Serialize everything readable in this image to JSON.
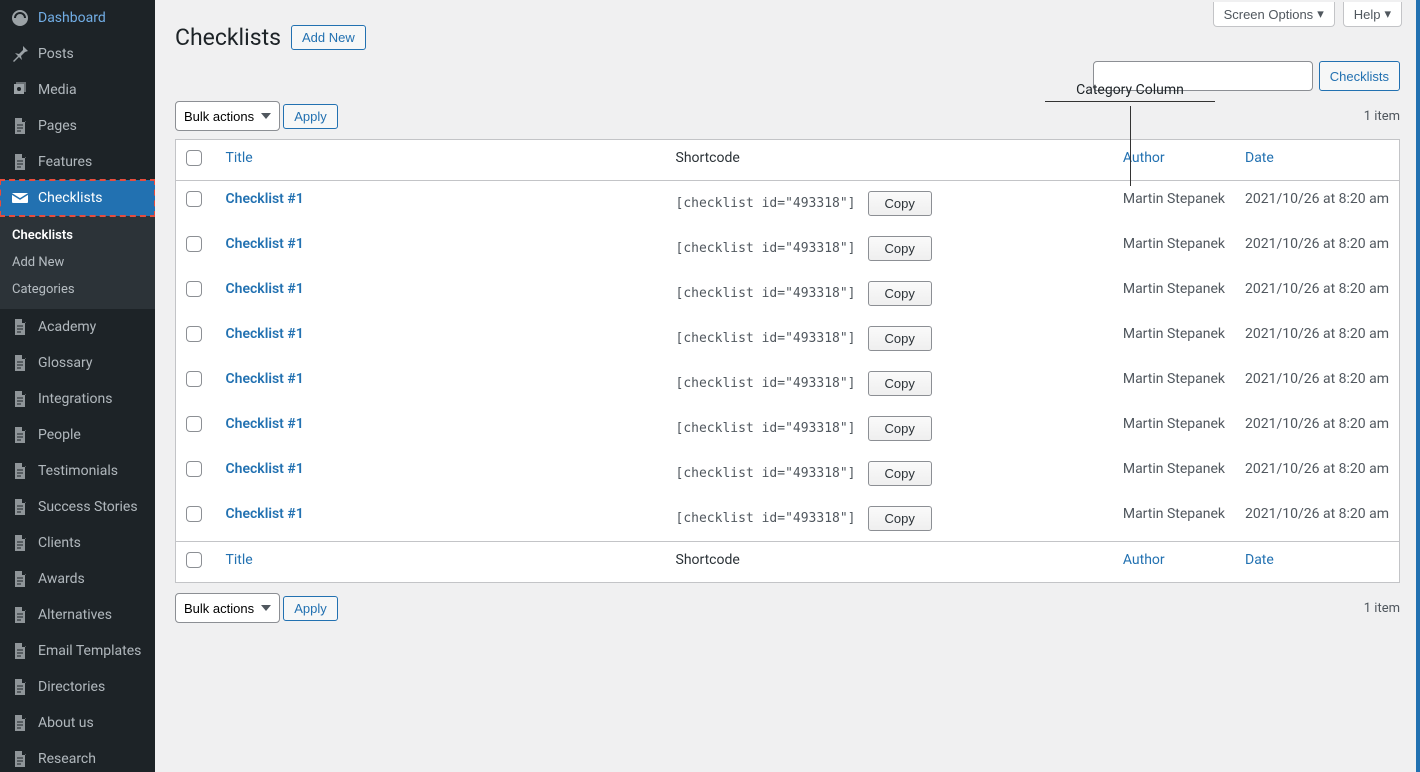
{
  "sidebar": {
    "items": [
      {
        "label": "Dashboard",
        "icon": "dashboard"
      },
      {
        "label": "Posts",
        "icon": "pin"
      },
      {
        "label": "Media",
        "icon": "media"
      },
      {
        "label": "Pages",
        "icon": "page"
      },
      {
        "label": "Features",
        "icon": "page"
      },
      {
        "label": "Checklists",
        "icon": "mail",
        "current": true
      },
      {
        "label": "Academy",
        "icon": "page"
      },
      {
        "label": "Glossary",
        "icon": "page"
      },
      {
        "label": "Integrations",
        "icon": "page"
      },
      {
        "label": "People",
        "icon": "page"
      },
      {
        "label": "Testimonials",
        "icon": "page"
      },
      {
        "label": "Success Stories",
        "icon": "page"
      },
      {
        "label": "Clients",
        "icon": "page"
      },
      {
        "label": "Awards",
        "icon": "page"
      },
      {
        "label": "Alternatives",
        "icon": "page"
      },
      {
        "label": "Email Templates",
        "icon": "page"
      },
      {
        "label": "Directories",
        "icon": "page"
      },
      {
        "label": "About us",
        "icon": "page"
      },
      {
        "label": "Research",
        "icon": "page"
      }
    ],
    "submenu": [
      {
        "label": "Checklists",
        "active": true
      },
      {
        "label": "Add New",
        "active": false
      },
      {
        "label": "Categories",
        "active": false
      }
    ]
  },
  "screen_meta": {
    "screen_options": "Screen Options",
    "help": "Help"
  },
  "header": {
    "title": "Checklists",
    "add_new": "Add New"
  },
  "search": {
    "value": "",
    "button": "Checklists"
  },
  "bulk": {
    "label": "Bulk actions",
    "apply": "Apply"
  },
  "item_count": "1 item",
  "annotation": "Category Column",
  "columns": {
    "title": "Title",
    "shortcode": "Shortcode",
    "author": "Author",
    "date": "Date"
  },
  "copy_label": "Copy",
  "rows": [
    {
      "title": "Checklist #1",
      "shortcode": "[checklist id=\"493318\"]",
      "author": "Martin Stepanek",
      "date": "2021/10/26 at 8:20 am"
    },
    {
      "title": "Checklist #1",
      "shortcode": "[checklist id=\"493318\"]",
      "author": "Martin Stepanek",
      "date": "2021/10/26 at 8:20 am"
    },
    {
      "title": "Checklist #1",
      "shortcode": "[checklist id=\"493318\"]",
      "author": "Martin Stepanek",
      "date": "2021/10/26 at 8:20 am"
    },
    {
      "title": "Checklist #1",
      "shortcode": "[checklist id=\"493318\"]",
      "author": "Martin Stepanek",
      "date": "2021/10/26 at 8:20 am"
    },
    {
      "title": "Checklist #1",
      "shortcode": "[checklist id=\"493318\"]",
      "author": "Martin Stepanek",
      "date": "2021/10/26 at 8:20 am"
    },
    {
      "title": "Checklist #1",
      "shortcode": "[checklist id=\"493318\"]",
      "author": "Martin Stepanek",
      "date": "2021/10/26 at 8:20 am"
    },
    {
      "title": "Checklist #1",
      "shortcode": "[checklist id=\"493318\"]",
      "author": "Martin Stepanek",
      "date": "2021/10/26 at 8:20 am"
    },
    {
      "title": "Checklist #1",
      "shortcode": "[checklist id=\"493318\"]",
      "author": "Martin Stepanek",
      "date": "2021/10/26 at 8:20 am"
    }
  ]
}
